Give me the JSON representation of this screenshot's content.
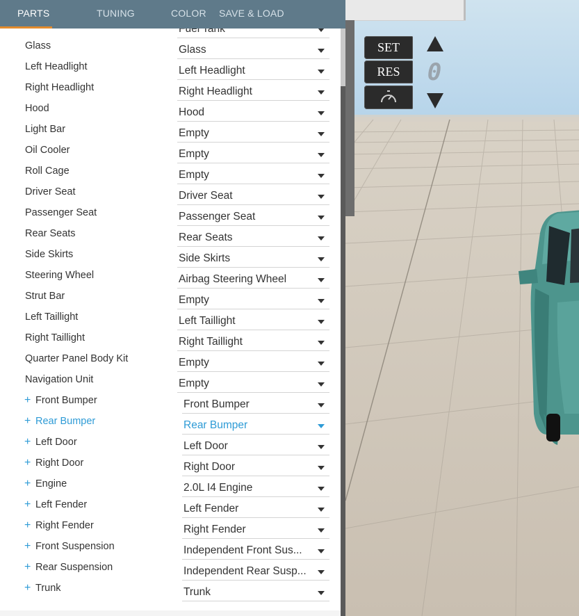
{
  "tabs": [
    {
      "label": "PARTS",
      "active": true
    },
    {
      "label": "TUNING",
      "active": false
    },
    {
      "label": "COLOR",
      "active": false
    },
    {
      "label": "SAVE & LOAD",
      "active": false
    }
  ],
  "rows": [
    {
      "label": "Fuel Tank",
      "value": "Fuel Tank",
      "plus": false
    },
    {
      "label": "Glass",
      "value": "Glass",
      "plus": false
    },
    {
      "label": "Left Headlight",
      "value": "Left Headlight",
      "plus": false
    },
    {
      "label": "Right Headlight",
      "value": "Right Headlight",
      "plus": false
    },
    {
      "label": "Hood",
      "value": "Hood",
      "plus": false
    },
    {
      "label": "Light Bar",
      "value": "Empty",
      "plus": false
    },
    {
      "label": "Oil Cooler",
      "value": "Empty",
      "plus": false
    },
    {
      "label": "Roll Cage",
      "value": "Empty",
      "plus": false
    },
    {
      "label": "Driver Seat",
      "value": "Driver Seat",
      "plus": false
    },
    {
      "label": "Passenger Seat",
      "value": "Passenger Seat",
      "plus": false
    },
    {
      "label": "Rear Seats",
      "value": "Rear Seats",
      "plus": false
    },
    {
      "label": "Side Skirts",
      "value": "Side Skirts",
      "plus": false
    },
    {
      "label": "Steering Wheel",
      "value": "Airbag Steering Wheel",
      "plus": false
    },
    {
      "label": "Strut Bar",
      "value": "Empty",
      "plus": false
    },
    {
      "label": "Left Taillight",
      "value": "Left Taillight",
      "plus": false
    },
    {
      "label": "Right Taillight",
      "value": "Right Taillight",
      "plus": false
    },
    {
      "label": "Quarter Panel Body Kit",
      "value": "Empty",
      "plus": false
    },
    {
      "label": "Navigation Unit",
      "value": "Empty",
      "plus": false
    },
    {
      "label": "Front Bumper",
      "value": "Front Bumper",
      "plus": true
    },
    {
      "label": "Rear Bumper",
      "value": "Rear Bumper",
      "plus": true,
      "highlight": true
    },
    {
      "label": "Left Door",
      "value": "Left Door",
      "plus": true
    },
    {
      "label": "Right Door",
      "value": "Right Door",
      "plus": true
    },
    {
      "label": "Engine",
      "value": "2.0L I4 Engine",
      "plus": true
    },
    {
      "label": "Left Fender",
      "value": "Left Fender",
      "plus": true
    },
    {
      "label": "Right Fender",
      "value": "Right Fender",
      "plus": true
    },
    {
      "label": "Front Suspension",
      "value": "Independent Front Sus...",
      "plus": true
    },
    {
      "label": "Rear Suspension",
      "value": "Independent Rear Susp...",
      "plus": true
    },
    {
      "label": "Trunk",
      "value": "Trunk",
      "plus": true
    }
  ],
  "plus_symbol": "+",
  "cruise_control": {
    "set_label": "SET",
    "res_label": "RES",
    "speed_digit": "0",
    "gauge_icon": "speedometer-icon",
    "up_icon": "triangle-up-icon",
    "down_icon": "triangle-down-icon"
  },
  "colors": {
    "tab_bar": "#5f7a8a",
    "tab_underline": "#e38b2c",
    "highlight": "#2e9bd6",
    "car_body": "#4f9a92"
  }
}
